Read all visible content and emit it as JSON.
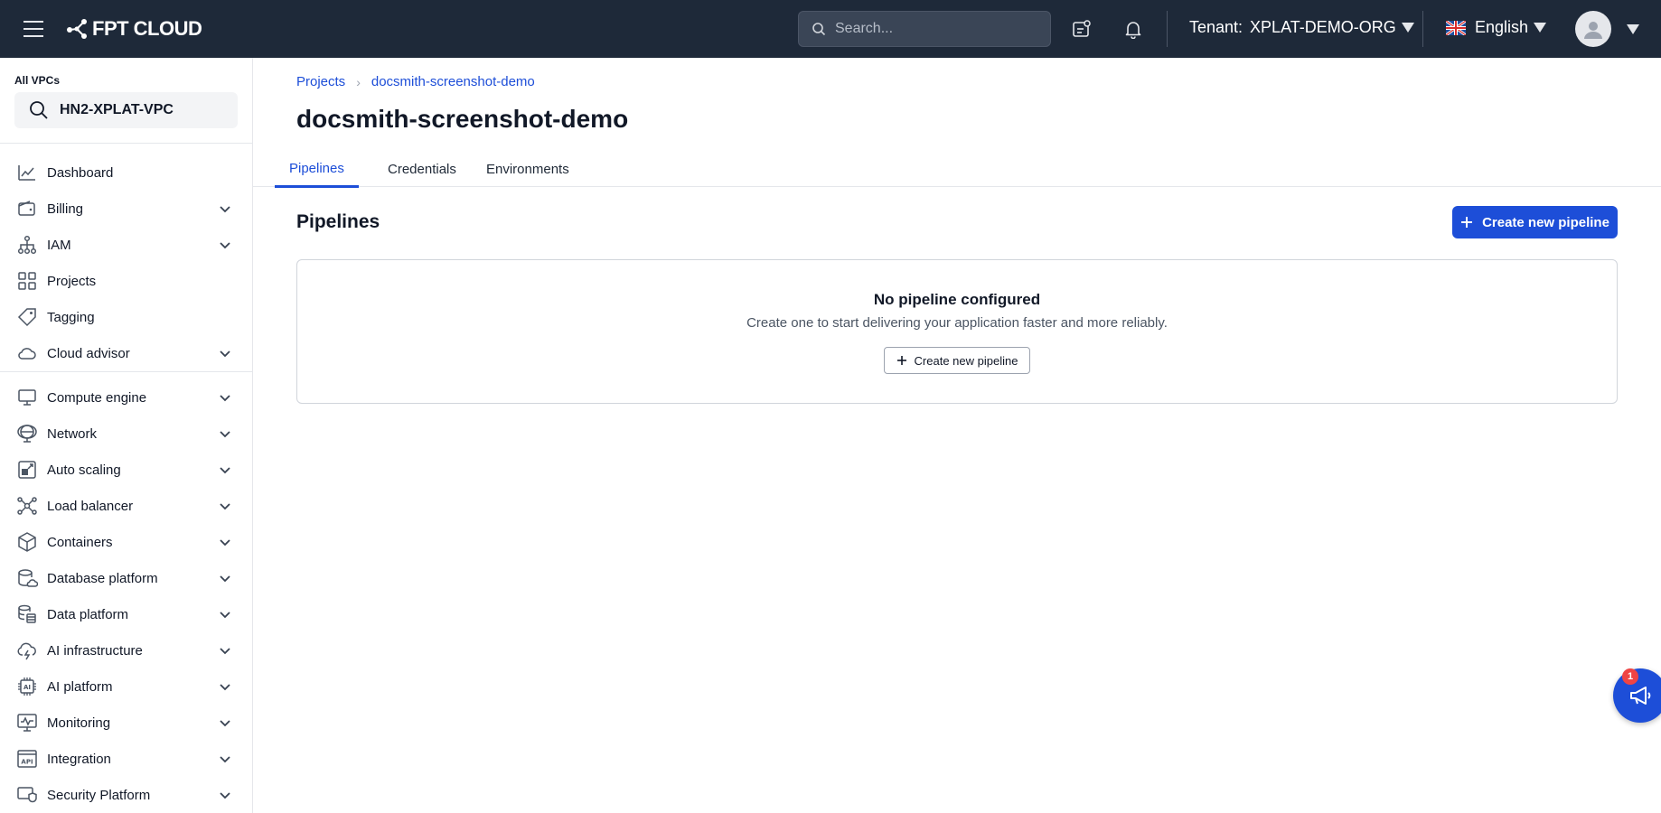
{
  "topbar": {
    "logo_text": "FPT CLOUD",
    "search_placeholder": "Search...",
    "tenant_label": "Tenant:",
    "tenant_value": "XPLAT-DEMO-ORG",
    "language": "English"
  },
  "sidebar": {
    "vpc_label": "All VPCs",
    "vpc_value": "HN2-XPLAT-VPC",
    "items": [
      {
        "label": "Dashboard",
        "icon": "chart-line-icon",
        "expandable": false
      },
      {
        "label": "Billing",
        "icon": "wallet-icon",
        "expandable": true
      },
      {
        "label": "IAM",
        "icon": "org-tree-icon",
        "expandable": true
      },
      {
        "label": "Projects",
        "icon": "grid-icon",
        "expandable": false
      },
      {
        "label": "Tagging",
        "icon": "tag-icon",
        "expandable": false
      },
      {
        "label": "Cloud advisor",
        "icon": "cloud-icon",
        "expandable": true
      },
      {
        "label": "Compute engine",
        "icon": "monitor-icon",
        "expandable": true
      },
      {
        "label": "Network",
        "icon": "globe-icon",
        "expandable": true
      },
      {
        "label": "Auto scaling",
        "icon": "scaling-icon",
        "expandable": true
      },
      {
        "label": "Load balancer",
        "icon": "load-balancer-icon",
        "expandable": true
      },
      {
        "label": "Containers",
        "icon": "box-icon",
        "expandable": true
      },
      {
        "label": "Database platform",
        "icon": "database-cloud-icon",
        "expandable": true
      },
      {
        "label": "Data platform",
        "icon": "database-stack-icon",
        "expandable": true
      },
      {
        "label": "AI infrastructure",
        "icon": "cloud-bolt-icon",
        "expandable": true
      },
      {
        "label": "AI platform",
        "icon": "ai-chip-icon",
        "expandable": true
      },
      {
        "label": "Monitoring",
        "icon": "monitoring-icon",
        "expandable": true
      },
      {
        "label": "Integration",
        "icon": "api-icon",
        "expandable": true
      },
      {
        "label": "Security Platform",
        "icon": "security-icon",
        "expandable": true
      }
    ]
  },
  "main": {
    "breadcrumb": [
      "Projects",
      "docsmith-screenshot-demo"
    ],
    "title": "docsmith-screenshot-demo",
    "tabs": [
      "Pipelines",
      "Credentials",
      "Environments"
    ],
    "active_tab": "Pipelines",
    "section_title": "Pipelines",
    "create_button": "Create new pipeline",
    "empty": {
      "title": "No pipeline configured",
      "subtitle": "Create one to start delivering your application faster and more reliably.",
      "button": "Create new pipeline"
    }
  },
  "fab": {
    "badge_count": "1",
    "icon": "megaphone-icon"
  },
  "colors": {
    "topbar": "#1e2939",
    "accent": "#1d4ed8",
    "badge": "#ef4444"
  }
}
